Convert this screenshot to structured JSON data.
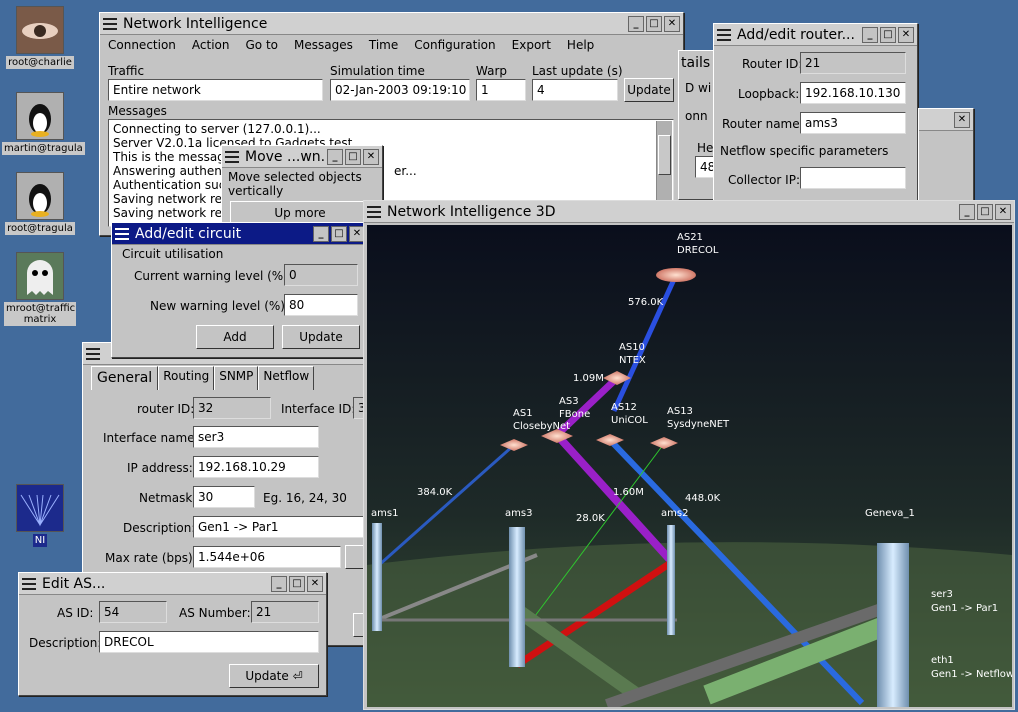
{
  "desktop": {
    "icons": [
      {
        "label": "root@charlie"
      },
      {
        "label": "martin@tragula"
      },
      {
        "label": "root@tragula"
      },
      {
        "label": "mroot@traffic matrix"
      },
      {
        "label": "NI"
      }
    ]
  },
  "main": {
    "title": "Network Intelligence",
    "menu": [
      "Connection",
      "Action",
      "Go to",
      "Messages",
      "Time",
      "Configuration",
      "Export",
      "Help"
    ],
    "traffic_label": "Traffic",
    "traffic_value": "Entire network",
    "simtime_label": "Simulation time",
    "simtime_value": "02-Jan-2003 09:19:10",
    "warp_label": "Warp",
    "warp_value": "1",
    "lastupdate_label": "Last update (s)",
    "lastupdate_value": "4",
    "update_button": "Update",
    "messages_label": "Messages",
    "messages": [
      "Connecting to server (127.0.0.1)...",
      "Server V2.0.1a licensed to Gadgets test",
      "This is the message",
      "Answering authenti",
      "Authentication succ",
      "Saving network rep",
      "Saving network rep"
    ],
    "msg_tail": "er..."
  },
  "details": {
    "title": "tails",
    "l1": "D wi",
    "l2": "onn",
    "l3": "He",
    "l4": "48"
  },
  "router": {
    "title": "Add/edit router...",
    "id_label": "Router ID:",
    "id_value": "21",
    "loop_label": "Loopback:",
    "loop_value": "192.168.10.130",
    "name_label": "Router name:",
    "name_value": "ams3",
    "netflow_label": "Netflow specific parameters",
    "collector_label": "Collector IP:",
    "collector_value": ""
  },
  "move": {
    "title": "Move ...wn...",
    "text": "Move selected objects vertically",
    "up": "Up more"
  },
  "circuit": {
    "title": "Add/edit circuit",
    "section": "Circuit utilisation",
    "cur_label": "Current warning level (%):",
    "cur_value": "0",
    "new_label": "New warning level (%):",
    "new_value": "80",
    "add": "Add",
    "update": "Update"
  },
  "iface": {
    "tabs": [
      "General",
      "Routing",
      "SNMP",
      "Netflow"
    ],
    "rid_label": "router ID:",
    "rid_value": "32",
    "iid_label": "Interface ID:",
    "iid_value": "3",
    "name_label": "Interface name:",
    "name_value": "ser3",
    "ip_label": "IP address:",
    "ip_value": "192.168.10.29",
    "mask_label": "Netmask:",
    "mask_value": "30",
    "mask_hint": "Eg. 16, 24, 30",
    "desc_label": "Description:",
    "desc_value": "Gen1 -> Par1",
    "rate_label": "Max rate (bps):",
    "rate_value": "1.544e+06"
  },
  "editas": {
    "title": "Edit AS...",
    "asid_label": "AS ID:",
    "asid_value": "54",
    "asnum_label": "AS Number:",
    "asnum_value": "21",
    "desc_label": "Description:",
    "desc_value": "DRECOL",
    "update": "Update"
  },
  "view3d": {
    "title": "Network Intelligence 3D",
    "nodes": [
      {
        "label": "AS21\nDRECOL"
      },
      {
        "label": "AS10\nNTEX"
      },
      {
        "label": "AS1\nClosebyNet"
      },
      {
        "label": "AS3\nFBone"
      },
      {
        "label": "AS12\nUniCOL"
      },
      {
        "label": "AS13\nSysdyneNET"
      }
    ],
    "links": [
      "576.0K",
      "1.09M",
      "384.0K",
      "1.60M",
      "448.0K",
      "28.0K"
    ],
    "routers": [
      "ams1",
      "ams3",
      "ams2",
      "Geneva_1"
    ],
    "annot": [
      {
        "a": "ser3",
        "b": "Gen1 -> Par1"
      },
      {
        "a": "eth1",
        "b": "Gen1 -> Netflow"
      }
    ],
    "colors": {
      "blue": "#2a4fe0",
      "purple": "#9a20c8",
      "red": "#d01010",
      "green": "#2ec82e"
    }
  }
}
